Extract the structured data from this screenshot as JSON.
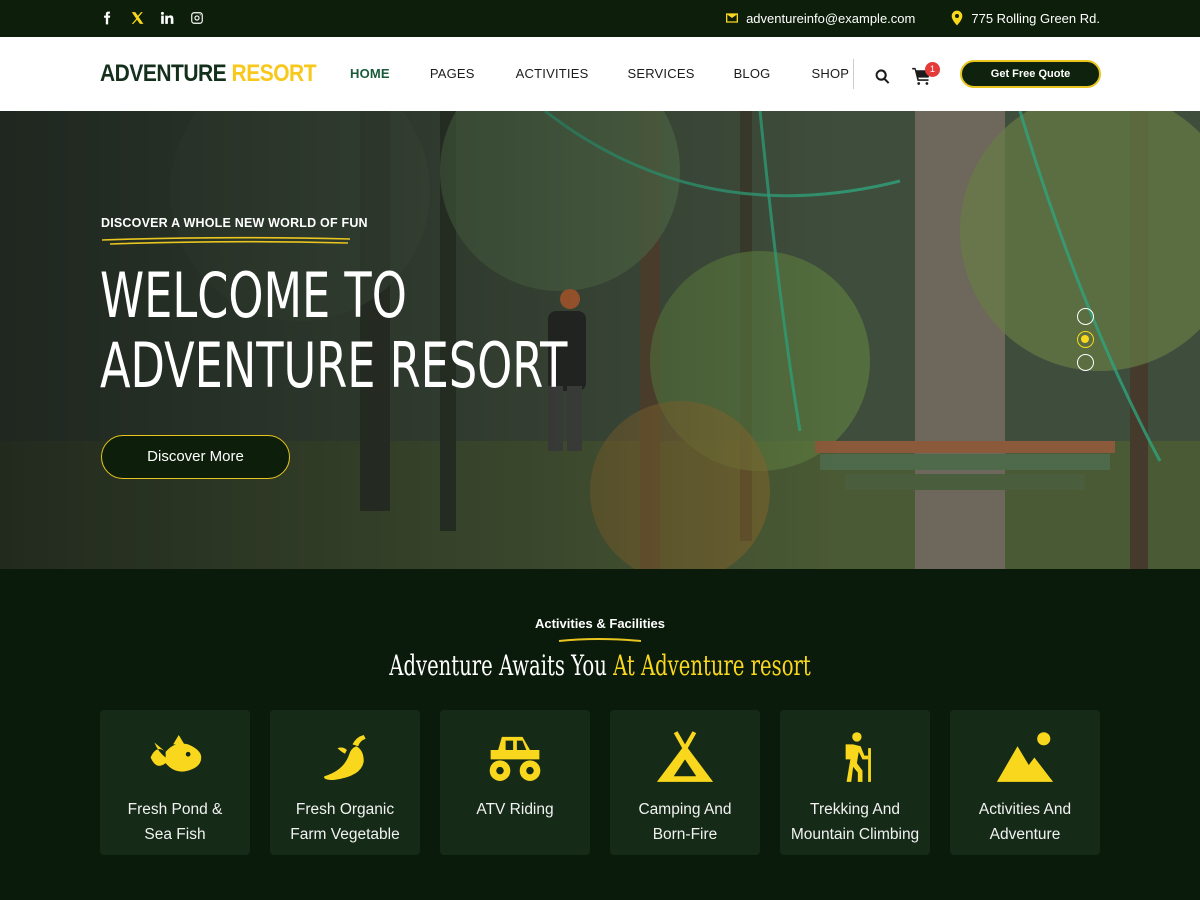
{
  "topbar": {
    "social_icons": [
      "facebook-icon",
      "x-twitter-icon",
      "linkedin-icon",
      "instagram-icon"
    ],
    "email": "adventureinfo@example.com",
    "address": "775 Rolling Green Rd."
  },
  "header": {
    "logo_part1": "ADVENTURE",
    "logo_part2": "RESORT",
    "nav": [
      "HOME",
      "PAGES",
      "ACTIVITIES",
      "SERVICES",
      "BLOG",
      "SHOP"
    ],
    "active_nav": "HOME",
    "cart_count": "1",
    "quote_label": "Get Free Quote"
  },
  "hero": {
    "eyebrow": "DISCOVER A WHOLE NEW WORLD OF FUN",
    "title_line1": "Welcome to",
    "title_line2": "Adventure Resort",
    "button_label": "Discover More",
    "slides": 3,
    "active_slide": 2
  },
  "activities": {
    "label": "Activities & Facilities",
    "title_plain": "Adventure Awaits You",
    "title_highlight": "At Adventure resort",
    "items": [
      {
        "icon": "fish-icon",
        "line1": "Fresh Pond &",
        "line2": "Sea Fish"
      },
      {
        "icon": "vegetable-icon",
        "line1": "Fresh Organic",
        "line2": "Farm Vegetable"
      },
      {
        "icon": "atv-icon",
        "line1": "ATV Riding",
        "line2": ""
      },
      {
        "icon": "tent-icon",
        "line1": "Camping And",
        "line2": "Born-Fire"
      },
      {
        "icon": "hiker-icon",
        "line1": "Trekking And",
        "line2": "Mountain Climbing"
      },
      {
        "icon": "mountain-icon",
        "line1": "Activities And",
        "line2": "Adventure"
      }
    ]
  },
  "colors": {
    "accent": "#f9d71c",
    "dark": "#0d1f0b",
    "active_nav": "#1a5b3a"
  }
}
